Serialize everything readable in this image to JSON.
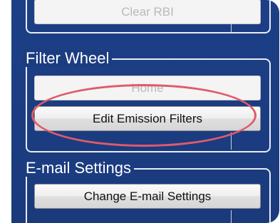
{
  "clear_rbi_group": {
    "button_label": "Clear RBI"
  },
  "filter_wheel_group": {
    "title": "Filter Wheel",
    "home_label": "Home",
    "edit_label": "Edit Emission Filters"
  },
  "email_group": {
    "title": "E-mail Settings",
    "change_label": "Change E-mail Settings"
  },
  "colors": {
    "panel": "#1b3c80",
    "highlight": "#e05a6b"
  }
}
